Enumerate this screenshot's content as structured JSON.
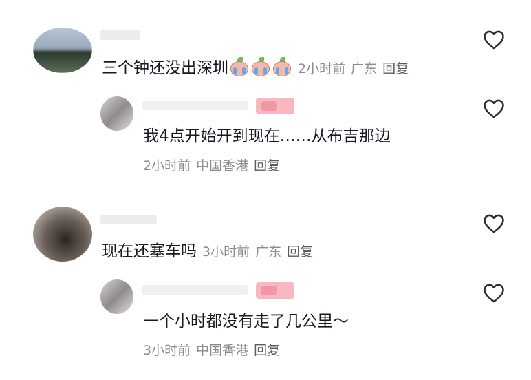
{
  "comments": [
    {
      "text": "三个钟还没出深圳",
      "emoji": "crying-face",
      "time": "2小时前",
      "location": "广东",
      "reply_label": "回复",
      "replies": [
        {
          "text": "我4点开始开到现在……从布吉那边",
          "time": "2小时前",
          "location": "中国香港",
          "reply_label": "回复"
        }
      ]
    },
    {
      "text": "现在还塞车吗",
      "time": "3小时前",
      "location": "广东",
      "reply_label": "回复",
      "replies": [
        {
          "text": "一个小时都没有走了几公里～",
          "time": "3小时前",
          "location": "中国香港",
          "reply_label": "回复"
        }
      ]
    }
  ],
  "icons": {
    "like": "heart-outline-icon",
    "emoji": "crying-peach-emoji-icon"
  },
  "colors": {
    "text": "#161823",
    "meta": "#8a8b91",
    "reply": "#5a5b62",
    "badge": "#f7b8c0"
  }
}
